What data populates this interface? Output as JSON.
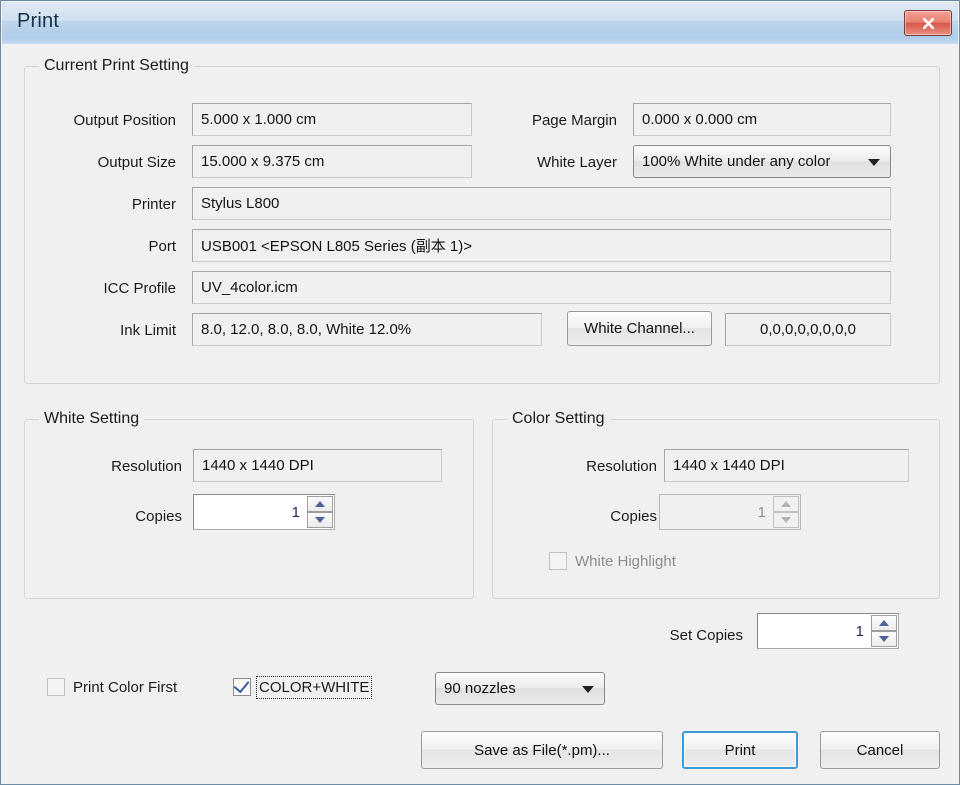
{
  "window": {
    "title": "Print",
    "close_label": "×",
    "close_icon": "close-icon"
  },
  "colors": {
    "dialog_bg": "#f0f0f0",
    "titlebar_top": "#dfe9f4",
    "titlebar_bottom": "#aeccea",
    "close_red": "#d9544a",
    "default_button_border": "#3c9ad6",
    "value_text": "#141414",
    "disabled_text": "#8d8d8d",
    "spin_value": "#2b2255"
  },
  "current_print_setting": {
    "group_title": "Current Print Setting",
    "output_position": {
      "label": "Output Position",
      "value": "5.000 x 1.000 cm"
    },
    "output_size": {
      "label": "Output Size",
      "value": "15.000 x 9.375 cm"
    },
    "page_margin": {
      "label": "Page Margin",
      "value": "0.000 x 0.000 cm"
    },
    "white_layer": {
      "label": "White Layer",
      "value": "100% White under any color",
      "caret_icon": "chevron-down-icon"
    },
    "printer": {
      "label": "Printer",
      "value": "Stylus L800"
    },
    "port": {
      "label": "Port",
      "value": "USB001  <EPSON L805 Series (副本 1)>"
    },
    "icc_profile": {
      "label": "ICC Profile",
      "value": "UV_4color.icm"
    },
    "ink_limit": {
      "label": "Ink Limit",
      "value": "8.0, 12.0, 8.0, 8.0, White 12.0%",
      "white_channel_button": "White Channel...",
      "channel_values": "0,0,0,0,0,0,0,0"
    }
  },
  "white_setting": {
    "group_title": "White Setting",
    "resolution": {
      "label": "Resolution",
      "value": "1440 x 1440 DPI"
    },
    "copies": {
      "label": "Copies",
      "value": "1",
      "enabled": true
    }
  },
  "color_setting": {
    "group_title": "Color Setting",
    "resolution": {
      "label": "Resolution",
      "value": "1440 x 1440 DPI"
    },
    "copies": {
      "label": "Copies",
      "value": "1",
      "enabled": false
    },
    "white_highlight": {
      "label": "White Highlight",
      "checked": false,
      "enabled": false
    }
  },
  "bottom": {
    "set_copies": {
      "label": "Set Copies",
      "value": "1"
    },
    "print_color_first": {
      "label": "Print Color First",
      "checked": false,
      "enabled": false
    },
    "color_white": {
      "label": "COLOR+WHITE",
      "checked": true,
      "enabled": true,
      "focused": true
    },
    "nozzles": {
      "value": "90 nozzles",
      "caret_icon": "chevron-down-icon"
    },
    "save_as_file_button": "Save as File(*.pm)...",
    "print_button": "Print",
    "cancel_button": "Cancel"
  }
}
